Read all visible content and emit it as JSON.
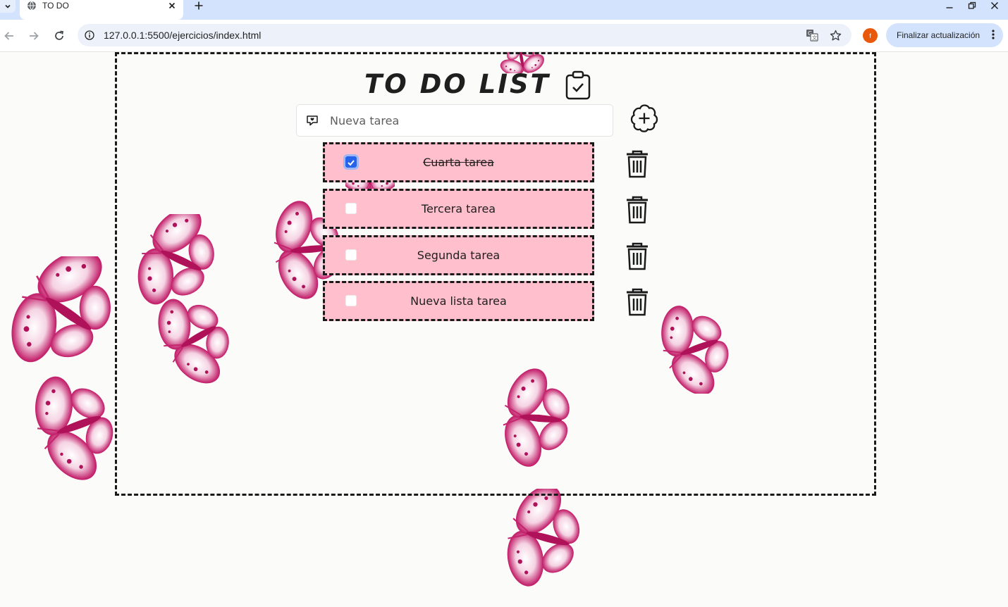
{
  "browser": {
    "tab_title": "TO DO",
    "url": "127.0.0.1:5500/ejercicios/index.html",
    "profile_initial": "f",
    "update_button": "Finalizar actualización",
    "accent_color": "#d3e3fd"
  },
  "app": {
    "title": "TO DO LIST",
    "input_placeholder": "Nueva tarea",
    "input_value": "",
    "task_color": "#ffbfcc",
    "tasks": [
      {
        "label": "Cuarta tarea",
        "checked": true
      },
      {
        "label": "Tercera tarea",
        "checked": false
      },
      {
        "label": "Segunda tarea",
        "checked": false
      },
      {
        "label": "Nueva lista tarea",
        "checked": false
      }
    ]
  }
}
